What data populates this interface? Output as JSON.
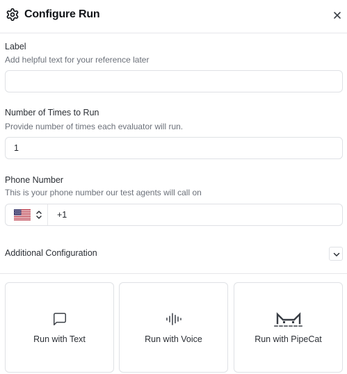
{
  "header": {
    "title": "Configure Run",
    "settings_icon": "gear-icon",
    "close_icon": "close-icon"
  },
  "label_field": {
    "label": "Label",
    "help": "Add helpful text for your reference later",
    "value": ""
  },
  "times_field": {
    "label": "Number of Times to Run",
    "help": "Provide number of times each evaluator will run.",
    "value": "1"
  },
  "phone_field": {
    "label": "Phone Number",
    "help": "This is your phone number our test agents will call on",
    "country_flag": "us-flag-icon",
    "value": "+1"
  },
  "additional": {
    "label": "Additional Configuration",
    "icon": "chevron-down-icon"
  },
  "run_options": [
    {
      "label": "Run with Text",
      "icon": "message-square-icon"
    },
    {
      "label": "Run with Voice",
      "icon": "audio-waveform-icon"
    },
    {
      "label": "Run with PipeCat",
      "icon": "pipecat-icon"
    }
  ],
  "colors": {
    "text": "#1f2329",
    "muted": "#6b7079",
    "border": "#dfe1e5",
    "divider": "#e6e7ea"
  }
}
